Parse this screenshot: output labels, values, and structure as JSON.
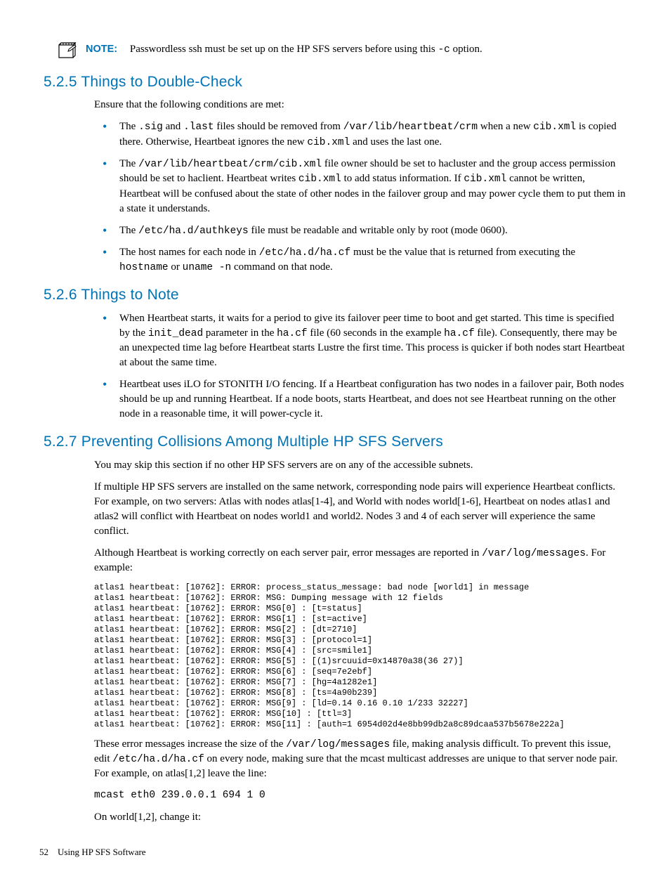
{
  "note": {
    "label": "NOTE:",
    "text_a": "Passwordless ssh must be set up on the HP SFS servers before using this ",
    "text_b": " option.",
    "code_c": "-c"
  },
  "s525": {
    "heading": "5.2.5 Things to Double-Check",
    "intro": "Ensure that the following conditions are met:",
    "b1_a": "The ",
    "b1_c1": ".sig",
    "b1_b": " and ",
    "b1_c2": ".last",
    "b1_c": " files should be removed from ",
    "b1_c3": "/var/lib/heartbeat/crm",
    "b1_d": " when a new ",
    "b1_c4": "cib.xml",
    "b1_e": " is copied there. Otherwise, Heartbeat ignores the new ",
    "b1_c5": "cib.xml",
    "b1_f": " and uses the last one.",
    "b2_a": "The ",
    "b2_c1": "/var/lib/heartbeat/crm/cib.xml",
    "b2_b": " file owner should be set to hacluster and the group access permission should be set to haclient. Heartbeat writes ",
    "b2_c2": "cib.xml",
    "b2_c": " to add status information. If ",
    "b2_c3": "cib.xml",
    "b2_d": " cannot be written, Heartbeat will be confused about the state of other nodes in the failover group and may power cycle them to put them in a state it understands.",
    "b3_a": "The ",
    "b3_c1": "/etc/ha.d/authkeys",
    "b3_b": " file must be readable and writable only by root (mode 0600).",
    "b4_a": "The host names for each node in ",
    "b4_c1": "/etc/ha.d/ha.cf",
    "b4_b": " must be the value that is returned from executing the ",
    "b4_c2": "hostname",
    "b4_c": " or ",
    "b4_c3": "uname -n",
    "b4_d": " command on that node."
  },
  "s526": {
    "heading": "5.2.6 Things to Note",
    "b1_a": "When Heartbeat starts, it waits for a period to give its failover peer time to boot and get started. This time is specified by the ",
    "b1_c1": "init_dead",
    "b1_b": " parameter in the ",
    "b1_c2": "ha.cf",
    "b1_c": " file (60 seconds in the example ",
    "b1_c3": "ha.cf",
    "b1_d": " file). Consequently, there may be an unexpected time lag before Heartbeat starts Lustre the first time. This process is quicker if both nodes start Heartbeat at about the same time.",
    "b2": "Heartbeat uses iLO for STONITH I/O fencing. If a Heartbeat configuration has two nodes in a failover pair, Both nodes should be up and running Heartbeat. If a node boots, starts Heartbeat, and does not see Heartbeat running on the other node in a reasonable time, it will power-cycle it."
  },
  "s527": {
    "heading": "5.2.7 Preventing Collisions Among Multiple HP SFS Servers",
    "p1": "You may skip this section if no other HP SFS servers are on any of the accessible subnets.",
    "p2": "If multiple HP SFS servers are installed on the same network, corresponding node pairs will experience Heartbeat conflicts. For example, on two servers: Atlas with nodes atlas[1-4], and World with nodes world[1-6], Heartbeat on nodes atlas1 and atlas2 will conflict with Heartbeat on nodes world1 and world2. Nodes 3 and 4 of each server will experience the same conflict.",
    "p3_a": "Although Heartbeat is working correctly on each server pair, error messages are reported in ",
    "p3_c1": "/var/log/messages",
    "p3_b": ". For example:",
    "log": "atlas1 heartbeat: [10762]: ERROR: process_status_message: bad node [world1] in message\natlas1 heartbeat: [10762]: ERROR: MSG: Dumping message with 12 fields\natlas1 heartbeat: [10762]: ERROR: MSG[0] : [t=status]\natlas1 heartbeat: [10762]: ERROR: MSG[1] : [st=active]\natlas1 heartbeat: [10762]: ERROR: MSG[2] : [dt=2710]\natlas1 heartbeat: [10762]: ERROR: MSG[3] : [protocol=1]\natlas1 heartbeat: [10762]: ERROR: MSG[4] : [src=smile1]\natlas1 heartbeat: [10762]: ERROR: MSG[5] : [(1)srcuuid=0x14870a38(36 27)]\natlas1 heartbeat: [10762]: ERROR: MSG[6] : [seq=7e2ebf]\natlas1 heartbeat: [10762]: ERROR: MSG[7] : [hg=4a1282e1]\natlas1 heartbeat: [10762]: ERROR: MSG[8] : [ts=4a90b239]\natlas1 heartbeat: [10762]: ERROR: MSG[9] : [ld=0.14 0.16 0.10 1/233 32227]\natlas1 heartbeat: [10762]: ERROR: MSG[10] : [ttl=3]\natlas1 heartbeat: [10762]: ERROR: MSG[11] : [auth=1 6954d02d4e8bb99db2a8c89dcaa537b5678e222a]",
    "p4_a": "These error messages increase the size of the ",
    "p4_c1": "/var/log/messages",
    "p4_b": " file, making analysis difficult. To prevent this issue, edit ",
    "p4_c2": "/etc/ha.d/ha.cf",
    "p4_c": " on every node, making sure that the mcast multicast addresses are unique to that server node pair. For example, on atlas[1,2] leave the line:",
    "cmd": "mcast eth0 239.0.0.1 694 1 0",
    "p5": "On world[1,2], change it:"
  },
  "footer": {
    "pagenum": "52",
    "title": "Using HP SFS Software"
  }
}
